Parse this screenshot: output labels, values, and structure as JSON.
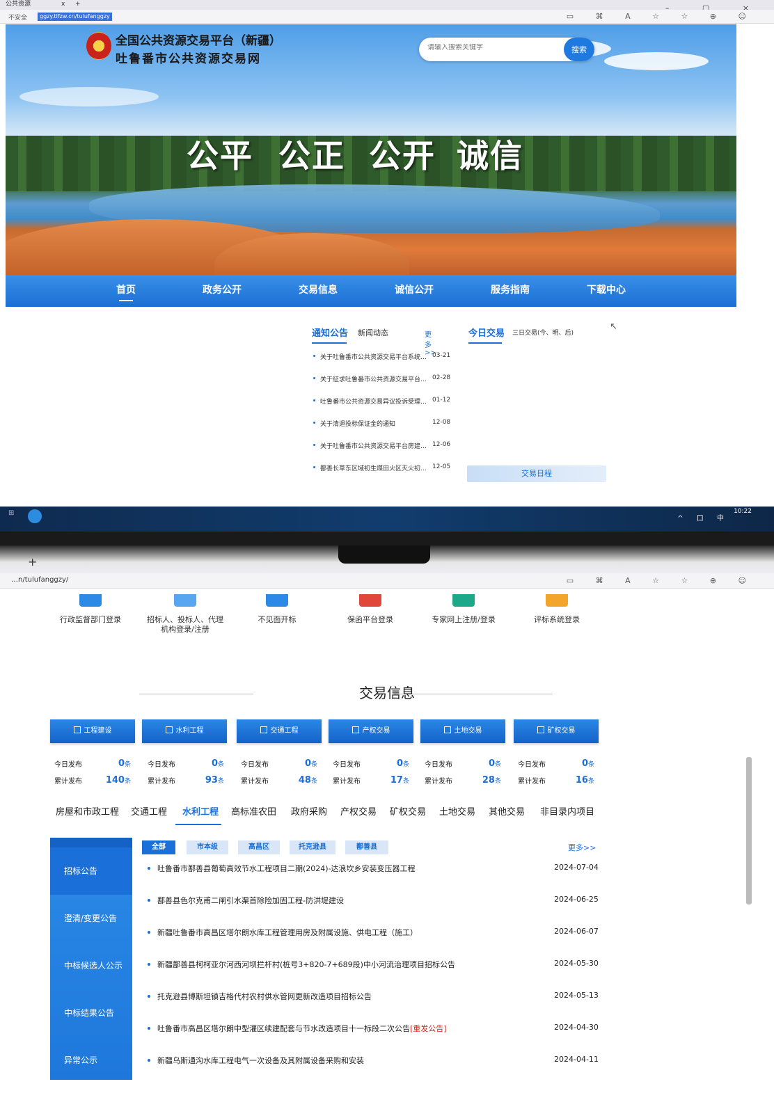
{
  "browser1": {
    "tab_title": "公共资源",
    "tab_close": "x",
    "new_tab": "+",
    "insecure": "不安全",
    "url": "ggzy.tlfzw.cn/tulufanggzy",
    "win_controls": "– ▢ ×",
    "tools": "▭ ⌘ A ☆ ☆ ⊕ ☺"
  },
  "site": {
    "name_line1": "全国公共资源交易平台（新疆）",
    "name_line2": "吐鲁番市公共资源交易网",
    "search_placeholder": "请输入搜索关键字",
    "search_button": "搜索",
    "slogan": [
      "公平",
      "公正",
      "公开",
      "诚信"
    ]
  },
  "nav": [
    "首页",
    "政务公开",
    "交易信息",
    "诚信公开",
    "服务指南",
    "下载中心"
  ],
  "notice": {
    "tab_active": "通知公告",
    "tab2": "新闻动态",
    "more": "更多>>",
    "today_tab": "今日交易",
    "today_tab2": "三日交易(今、明、后)",
    "schedule_button": "交易日程",
    "items": [
      {
        "title": "关于吐鲁番市公共资源交易平台系统迁…",
        "date": "03-21"
      },
      {
        "title": "关于征求吐鲁番市公共资源交易平台使…",
        "date": "02-28"
      },
      {
        "title": "吐鲁番市公共资源交易异议投诉受理渠道",
        "date": "01-12"
      },
      {
        "title": "关于清退投标保证金的通知",
        "date": "12-08"
      },
      {
        "title": "关于吐鲁番市公共资源交易平台房建市…",
        "date": "12-06"
      },
      {
        "title": "鄯善长草东区域初生煤田火区灭火初步…",
        "date": "12-05"
      }
    ]
  },
  "taskbar": {
    "clock": "10:22",
    "tray": "^ 口 中"
  },
  "browser2": {
    "url": "…n/tulufanggzy/",
    "new_tab": "+"
  },
  "quick_links": [
    "行政监督部门登录",
    "招标人、投标人、代理\n机构登录/注册",
    "不见面开标",
    "保函平台登录",
    "专家网上注册/登录",
    "评标系统登录"
  ],
  "section_title": "交易信息",
  "categories": [
    {
      "name": "工程建设",
      "today": "0",
      "total": "140"
    },
    {
      "name": "水利工程",
      "today": "0",
      "total": "93"
    },
    {
      "name": "交通工程",
      "today": "0",
      "total": "48"
    },
    {
      "name": "产权交易",
      "today": "0",
      "total": "17"
    },
    {
      "name": "土地交易",
      "today": "0",
      "total": "28"
    },
    {
      "name": "矿权交易",
      "today": "0",
      "total": "16"
    }
  ],
  "stat_labels": {
    "today": "今日发布",
    "total": "累计发布",
    "unit": "条"
  },
  "content_tabs": [
    "房屋和市政工程",
    "交通工程",
    "水利工程",
    "高标准农田",
    "政府采购",
    "产权交易",
    "矿权交易",
    "土地交易",
    "其他交易",
    "非目录内项目"
  ],
  "left_menu": [
    "招标公告",
    "澄清/变更公告",
    "中标候选人公示",
    "中标结果公告",
    "异常公示"
  ],
  "filters": [
    "全部",
    "市本级",
    "高昌区",
    "托克逊县",
    "鄯善县"
  ],
  "more2": "更多>>",
  "projects": [
    {
      "title": "吐鲁番市鄯善县葡萄高效节水工程项目二期(2024)-达浪坎乡安装变压器工程",
      "date": "2024-07-04"
    },
    {
      "title": "鄯善县色尔克甫二闸引水渠首除险加固工程-防洪堤建设",
      "date": "2024-06-25"
    },
    {
      "title": "新疆吐鲁番市高昌区塔尔朗水库工程管理用房及附属设施、供电工程（施工）",
      "date": "2024-06-07"
    },
    {
      "title": "新疆鄯善县柯柯亚尔河西河坝拦杆村(桩号3+820-7+689段)中小河流治理项目招标公告",
      "date": "2024-05-30"
    },
    {
      "title": "托克逊县博斯坦镇吉格代村农村供水管网更新改造项目招标公告",
      "date": "2024-05-13"
    },
    {
      "title": "吐鲁番市高昌区塔尔朗中型灌区续建配套与节水改造项目十一标段二次公告",
      "date": "2024-04-30",
      "flag": "[重发公告]"
    },
    {
      "title": "新疆乌斯通沟水库工程电气一次设备及其附属设备采购和安装",
      "date": "2024-04-11"
    }
  ],
  "colors": {
    "primary": "#1a6fd8",
    "nav": "#1b6fd4",
    "highlight": "#d0261f"
  }
}
